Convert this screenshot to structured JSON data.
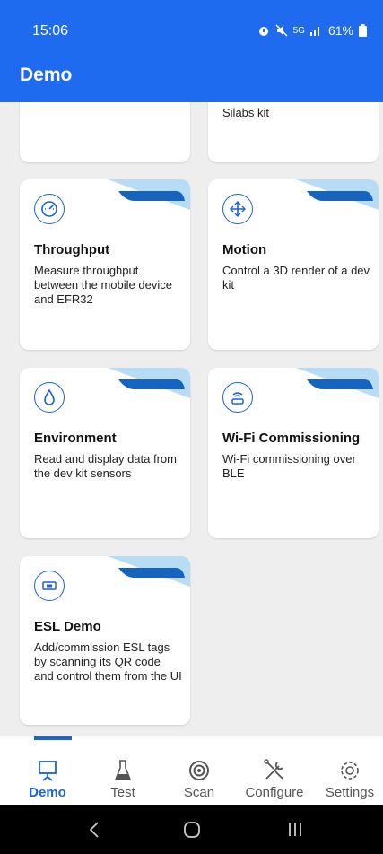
{
  "status": {
    "time": "15:06",
    "battery": "61%",
    "signal": "5G"
  },
  "app": {
    "title": "Demo"
  },
  "cards": [
    {
      "title": "",
      "desc": "",
      "partial_desc": "Silabs kit"
    },
    {
      "title": "Throughput",
      "desc": "Measure throughput between the mobile device and EFR32",
      "icon": "speedometer-icon"
    },
    {
      "title": "Motion",
      "desc": "Control a 3D render of a dev kit",
      "icon": "move-arrows-icon"
    },
    {
      "title": "Environment",
      "desc": "Read and display data from the dev kit sensors",
      "icon": "droplet-icon"
    },
    {
      "title": "Wi-Fi Commissioning",
      "desc": "Wi-Fi commissioning over BLE",
      "icon": "wifi-router-icon"
    },
    {
      "title": "ESL Demo",
      "desc": "Add/commission ESL tags by scanning its QR code and control them from the UI",
      "icon": "esl-tag-icon"
    }
  ],
  "nav": [
    {
      "label": "Demo",
      "icon": "easel-icon"
    },
    {
      "label": "Test",
      "icon": "flask-icon"
    },
    {
      "label": "Scan",
      "icon": "scan-icon"
    },
    {
      "label": "Configure",
      "icon": "tools-icon"
    },
    {
      "label": "Settings",
      "icon": "gear-icon"
    }
  ],
  "colors": {
    "primary": "#1f6bf0",
    "accent": "#1a62d6",
    "ribbon_light": "#b9dcf5"
  }
}
